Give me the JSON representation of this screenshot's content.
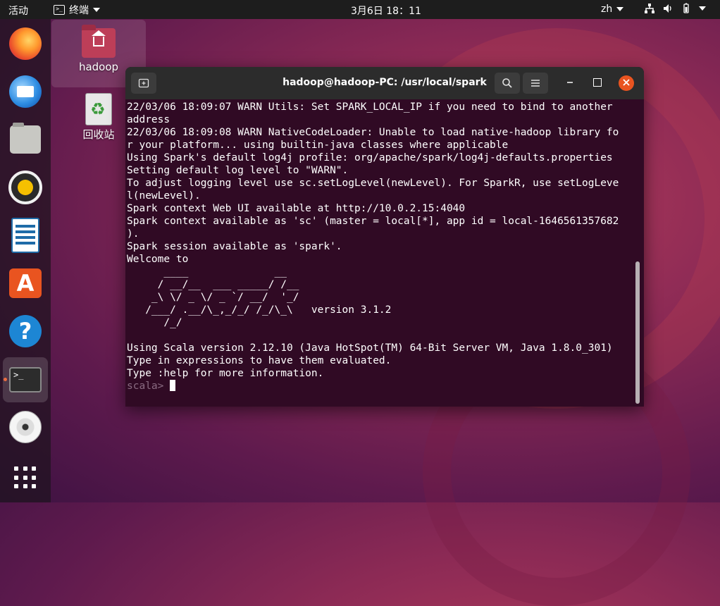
{
  "topbar": {
    "activities": "活动",
    "app_menu": "终端",
    "clock": "3月6日  18：11",
    "lang": "zh"
  },
  "dock": {
    "items": [
      {
        "name": "firefox-icon"
      },
      {
        "name": "thunderbird-icon"
      },
      {
        "name": "files-icon"
      },
      {
        "name": "rhythmbox-icon"
      },
      {
        "name": "libreoffice-writer-icon"
      },
      {
        "name": "software-center-icon"
      },
      {
        "name": "help-icon"
      },
      {
        "name": "terminal-icon",
        "active": true
      },
      {
        "name": "disc-icon"
      },
      {
        "name": "show-apps-icon"
      }
    ]
  },
  "desktop": {
    "home_label": "hadoop",
    "trash_label": "回收站"
  },
  "terminal": {
    "title": "hadoop@hadoop-PC: /usr/local/spark",
    "output": "22/03/06 18:09:07 WARN Utils: Set SPARK_LOCAL_IP if you need to bind to another\naddress\n22/03/06 18:09:08 WARN NativeCodeLoader: Unable to load native-hadoop library fo\nr your platform... using builtin-java classes where applicable\nUsing Spark's default log4j profile: org/apache/spark/log4j-defaults.properties\nSetting default log level to \"WARN\".\nTo adjust logging level use sc.setLogLevel(newLevel). For SparkR, use setLogLeve\nl(newLevel).\nSpark context Web UI available at http://10.0.2.15:4040\nSpark context available as 'sc' (master = local[*], app id = local-1646561357682\n).\nSpark session available as 'spark'.\nWelcome to\n      ____              __\n     / __/__  ___ _____/ /__\n    _\\ \\/ _ \\/ _ `/ __/  '_/\n   /___/ .__/\\_,_/_/ /_/\\_\\   version 3.1.2\n      /_/\n\nUsing Scala version 2.12.10 (Java HotSpot(TM) 64-Bit Server VM, Java 1.8.0_301)\nType in expressions to have them evaluated.\nType :help for more information.\n",
    "prompt": "scala> "
  }
}
